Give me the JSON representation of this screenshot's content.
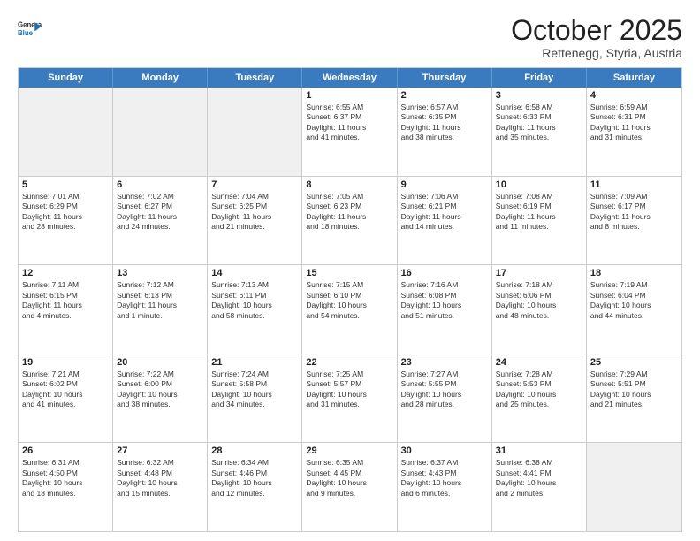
{
  "header": {
    "logo_general": "General",
    "logo_blue": "Blue",
    "month": "October 2025",
    "location": "Rettenegg, Styria, Austria"
  },
  "days_of_week": [
    "Sunday",
    "Monday",
    "Tuesday",
    "Wednesday",
    "Thursday",
    "Friday",
    "Saturday"
  ],
  "weeks": [
    [
      {
        "day": "",
        "info": "",
        "shaded": true
      },
      {
        "day": "",
        "info": "",
        "shaded": true
      },
      {
        "day": "",
        "info": "",
        "shaded": true
      },
      {
        "day": "1",
        "info": "Sunrise: 6:55 AM\nSunset: 6:37 PM\nDaylight: 11 hours\nand 41 minutes."
      },
      {
        "day": "2",
        "info": "Sunrise: 6:57 AM\nSunset: 6:35 PM\nDaylight: 11 hours\nand 38 minutes."
      },
      {
        "day": "3",
        "info": "Sunrise: 6:58 AM\nSunset: 6:33 PM\nDaylight: 11 hours\nand 35 minutes."
      },
      {
        "day": "4",
        "info": "Sunrise: 6:59 AM\nSunset: 6:31 PM\nDaylight: 11 hours\nand 31 minutes."
      }
    ],
    [
      {
        "day": "5",
        "info": "Sunrise: 7:01 AM\nSunset: 6:29 PM\nDaylight: 11 hours\nand 28 minutes."
      },
      {
        "day": "6",
        "info": "Sunrise: 7:02 AM\nSunset: 6:27 PM\nDaylight: 11 hours\nand 24 minutes."
      },
      {
        "day": "7",
        "info": "Sunrise: 7:04 AM\nSunset: 6:25 PM\nDaylight: 11 hours\nand 21 minutes."
      },
      {
        "day": "8",
        "info": "Sunrise: 7:05 AM\nSunset: 6:23 PM\nDaylight: 11 hours\nand 18 minutes."
      },
      {
        "day": "9",
        "info": "Sunrise: 7:06 AM\nSunset: 6:21 PM\nDaylight: 11 hours\nand 14 minutes."
      },
      {
        "day": "10",
        "info": "Sunrise: 7:08 AM\nSunset: 6:19 PM\nDaylight: 11 hours\nand 11 minutes."
      },
      {
        "day": "11",
        "info": "Sunrise: 7:09 AM\nSunset: 6:17 PM\nDaylight: 11 hours\nand 8 minutes."
      }
    ],
    [
      {
        "day": "12",
        "info": "Sunrise: 7:11 AM\nSunset: 6:15 PM\nDaylight: 11 hours\nand 4 minutes."
      },
      {
        "day": "13",
        "info": "Sunrise: 7:12 AM\nSunset: 6:13 PM\nDaylight: 11 hours\nand 1 minute."
      },
      {
        "day": "14",
        "info": "Sunrise: 7:13 AM\nSunset: 6:11 PM\nDaylight: 10 hours\nand 58 minutes."
      },
      {
        "day": "15",
        "info": "Sunrise: 7:15 AM\nSunset: 6:10 PM\nDaylight: 10 hours\nand 54 minutes."
      },
      {
        "day": "16",
        "info": "Sunrise: 7:16 AM\nSunset: 6:08 PM\nDaylight: 10 hours\nand 51 minutes."
      },
      {
        "day": "17",
        "info": "Sunrise: 7:18 AM\nSunset: 6:06 PM\nDaylight: 10 hours\nand 48 minutes."
      },
      {
        "day": "18",
        "info": "Sunrise: 7:19 AM\nSunset: 6:04 PM\nDaylight: 10 hours\nand 44 minutes."
      }
    ],
    [
      {
        "day": "19",
        "info": "Sunrise: 7:21 AM\nSunset: 6:02 PM\nDaylight: 10 hours\nand 41 minutes."
      },
      {
        "day": "20",
        "info": "Sunrise: 7:22 AM\nSunset: 6:00 PM\nDaylight: 10 hours\nand 38 minutes."
      },
      {
        "day": "21",
        "info": "Sunrise: 7:24 AM\nSunset: 5:58 PM\nDaylight: 10 hours\nand 34 minutes."
      },
      {
        "day": "22",
        "info": "Sunrise: 7:25 AM\nSunset: 5:57 PM\nDaylight: 10 hours\nand 31 minutes."
      },
      {
        "day": "23",
        "info": "Sunrise: 7:27 AM\nSunset: 5:55 PM\nDaylight: 10 hours\nand 28 minutes."
      },
      {
        "day": "24",
        "info": "Sunrise: 7:28 AM\nSunset: 5:53 PM\nDaylight: 10 hours\nand 25 minutes."
      },
      {
        "day": "25",
        "info": "Sunrise: 7:29 AM\nSunset: 5:51 PM\nDaylight: 10 hours\nand 21 minutes."
      }
    ],
    [
      {
        "day": "26",
        "info": "Sunrise: 6:31 AM\nSunset: 4:50 PM\nDaylight: 10 hours\nand 18 minutes."
      },
      {
        "day": "27",
        "info": "Sunrise: 6:32 AM\nSunset: 4:48 PM\nDaylight: 10 hours\nand 15 minutes."
      },
      {
        "day": "28",
        "info": "Sunrise: 6:34 AM\nSunset: 4:46 PM\nDaylight: 10 hours\nand 12 minutes."
      },
      {
        "day": "29",
        "info": "Sunrise: 6:35 AM\nSunset: 4:45 PM\nDaylight: 10 hours\nand 9 minutes."
      },
      {
        "day": "30",
        "info": "Sunrise: 6:37 AM\nSunset: 4:43 PM\nDaylight: 10 hours\nand 6 minutes."
      },
      {
        "day": "31",
        "info": "Sunrise: 6:38 AM\nSunset: 4:41 PM\nDaylight: 10 hours\nand 2 minutes."
      },
      {
        "day": "",
        "info": "",
        "shaded": true
      }
    ]
  ]
}
